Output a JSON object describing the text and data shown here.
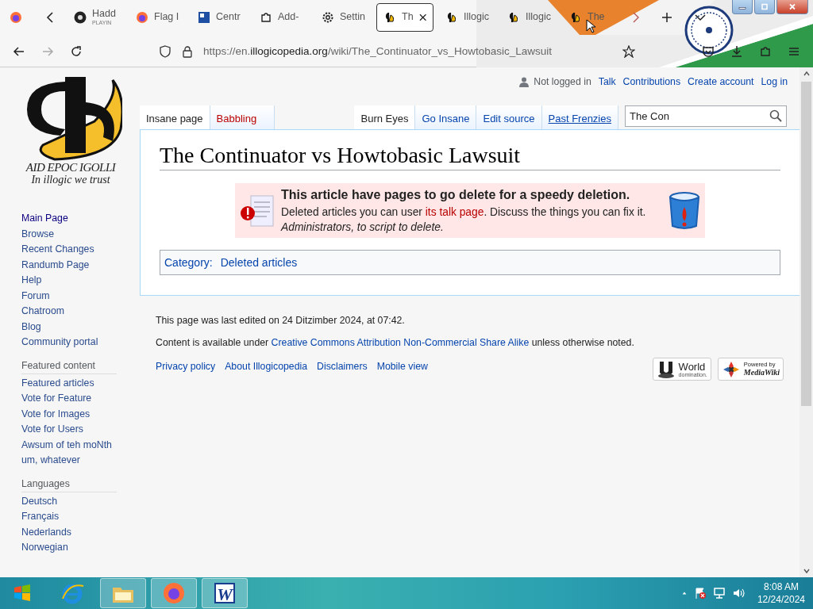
{
  "browser": {
    "tabs": [
      {
        "kind": "audio",
        "label": "Hadd",
        "subtitle": "PLAYIN",
        "selected": false
      },
      {
        "kind": "firefox",
        "label": "Flag I",
        "selected": false
      },
      {
        "kind": "square",
        "label": "Centr",
        "selected": false
      },
      {
        "kind": "puzzle",
        "label": "Add-",
        "selected": false
      },
      {
        "kind": "gear",
        "label": "Settin",
        "selected": false
      },
      {
        "kind": "site",
        "label": "Th",
        "selected": true
      },
      {
        "kind": "site",
        "label": "Illogic",
        "selected": false
      },
      {
        "kind": "site",
        "label": "Illogic",
        "selected": false
      },
      {
        "kind": "site",
        "label": "The",
        "selected": false
      }
    ],
    "url": {
      "prefix": "https://en.",
      "domain": "illogicopedia.org",
      "path": "/wiki/The_Continuator_vs_Howtobasic_Lawsuit"
    }
  },
  "logo": {
    "name": "AID EPOC IGOLLI",
    "motto": "In illogic we trust"
  },
  "sidebar": {
    "navigation": [
      "Main Page",
      "Browse",
      "Recent Changes",
      "Randumb Page",
      "Help",
      "Forum",
      "Chatroom",
      "Blog",
      "Community portal"
    ],
    "sections": [
      {
        "heading": "Featured content",
        "items": [
          "Featured articles",
          "Vote for Feature",
          "Vote for Images",
          "Vote for Users",
          "Awsum of teh moNth",
          "um, whatever"
        ]
      },
      {
        "heading": "Languages",
        "items": [
          "Deutsch",
          "Français",
          "Nederlands",
          "Norwegian"
        ]
      }
    ]
  },
  "personal_tools": {
    "status": "Not logged in",
    "links": [
      "Talk",
      "Contributions",
      "Create account",
      "Log in"
    ]
  },
  "namespace_tabs": [
    {
      "label": "Insane page",
      "selected": true,
      "redlink": false
    },
    {
      "label": "Babbling",
      "selected": false,
      "redlink": true
    }
  ],
  "view_tabs": [
    {
      "label": "Burn Eyes",
      "selected": true,
      "hovered": false
    },
    {
      "label": "Go Insane",
      "selected": false,
      "hovered": false
    },
    {
      "label": "Edit source",
      "selected": false,
      "hovered": false
    },
    {
      "label": "Past Frenzies",
      "selected": false,
      "hovered": true
    }
  ],
  "search": {
    "value": "The Con"
  },
  "title": "The Continuator vs Howtobasic Lawsuit",
  "notice": {
    "title": "This article have pages to go delete for a speedy deletion.",
    "text_before": "Deleted articles you can user ",
    "link": "its talk page",
    "text_after": ". Discuss the things you can fix it.",
    "note": "Administrators, to script to delete."
  },
  "categories": {
    "label": "Category:",
    "items": [
      "Deleted articles"
    ]
  },
  "footer": {
    "last_edited": "This page was last edited on 24 Ditzimber 2024, at 07:42.",
    "license_before": "Content is available under ",
    "license_link": "Creative Commons Attribution Non-Commercial Share Alike",
    "license_after": " unless otherwise noted.",
    "links": [
      "Privacy policy",
      "About Illogicopedia",
      "Disclaimers",
      "Mobile view"
    ],
    "badges": [
      {
        "kind": "world",
        "line1": "World",
        "line2": "domination."
      },
      {
        "kind": "mediawiki",
        "line1": "Powered by",
        "line2": "MediaWiki"
      }
    ]
  },
  "taskbar": {
    "apps": [
      {
        "kind": "ie",
        "open": false
      },
      {
        "kind": "folder",
        "open": true
      },
      {
        "kind": "firefox",
        "open": true
      },
      {
        "kind": "word",
        "open": true,
        "label": "W"
      }
    ],
    "time": "8:08 AM",
    "date": "12/24/2024"
  }
}
